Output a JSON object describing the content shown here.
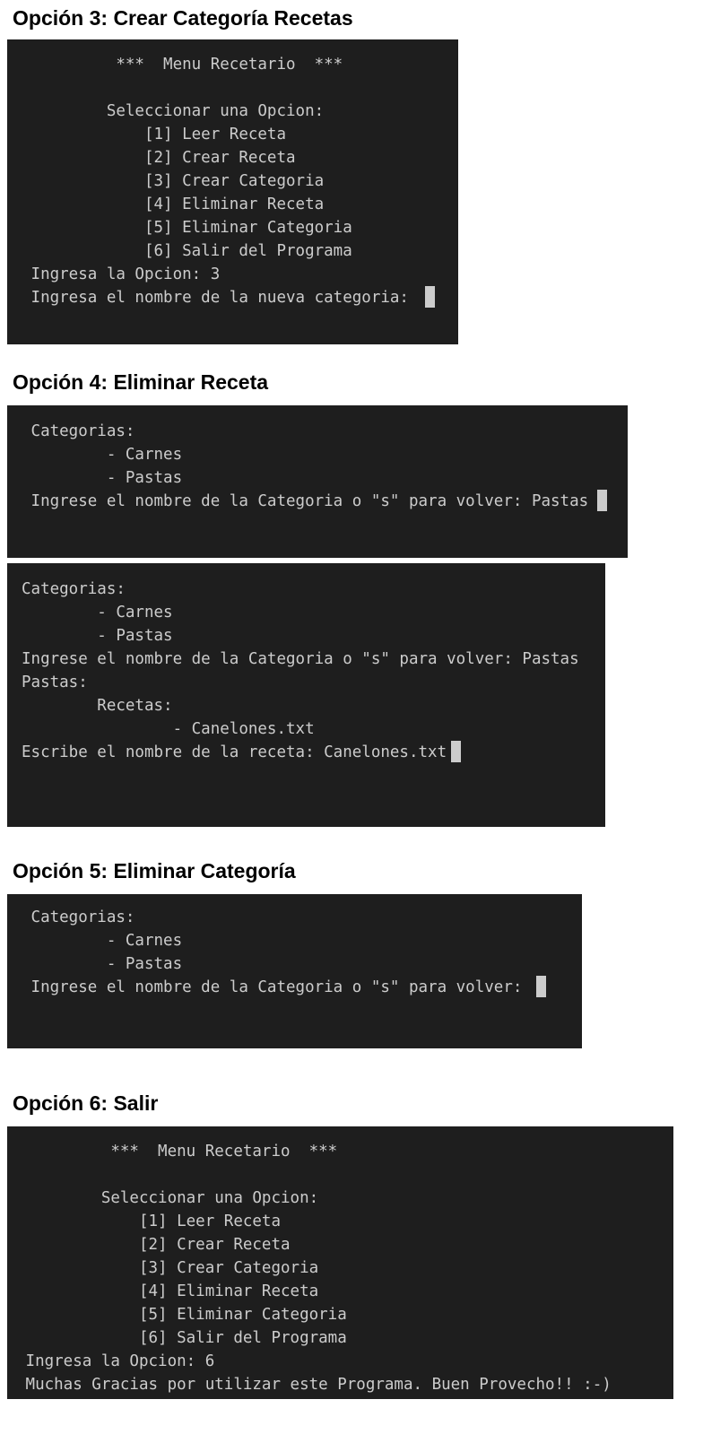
{
  "sections": {
    "s3": {
      "heading": "Opción 3: Crear Categoría Recetas",
      "lines": [
        "          ***  Menu Recetario  ***",
        "",
        "         Seleccionar una Opcion:",
        "             [1] Leer Receta",
        "             [2] Crear Receta",
        "             [3] Crear Categoria",
        "             [4] Eliminar Receta",
        "             [5] Eliminar Categoria",
        "             [6] Salir del Programa",
        " Ingresa la Opcion: 3",
        " Ingresa el nombre de la nueva categoria: "
      ]
    },
    "s4": {
      "heading": "Opción 4: Eliminar Receta",
      "lines": [
        " Categorias:",
        "         - Carnes",
        "         - Pastas",
        " Ingrese el nombre de la Categoria o \"s\" para volver: Pastas"
      ]
    },
    "s4b": {
      "lines": [
        "Categorias:",
        "        - Carnes",
        "        - Pastas",
        "Ingrese el nombre de la Categoria o \"s\" para volver: Pastas",
        "Pastas:",
        "        Recetas:",
        "                - Canelones.txt",
        "Escribe el nombre de la receta: Canelones.txt"
      ]
    },
    "s5": {
      "heading": "Opción 5: Eliminar Categoría",
      "lines": [
        " Categorias:",
        "         - Carnes",
        "         - Pastas",
        " Ingrese el nombre de la Categoria o \"s\" para volver: "
      ]
    },
    "s6": {
      "heading": "Opción 6: Salir",
      "lines": [
        "          ***  Menu Recetario  ***",
        "",
        "         Seleccionar una Opcion:",
        "             [1] Leer Receta",
        "             [2] Crear Receta",
        "             [3] Crear Categoria",
        "             [4] Eliminar Receta",
        "             [5] Eliminar Categoria",
        "             [6] Salir del Programa",
        " Ingresa la Opcion: 6",
        " Muchas Gracias por utilizar este Programa. Buen Provecho!! :-)"
      ]
    }
  },
  "colors": {
    "terminal_bg": "#1e1e1e",
    "terminal_text": "#cccccc",
    "cursor": "#cccccc"
  }
}
